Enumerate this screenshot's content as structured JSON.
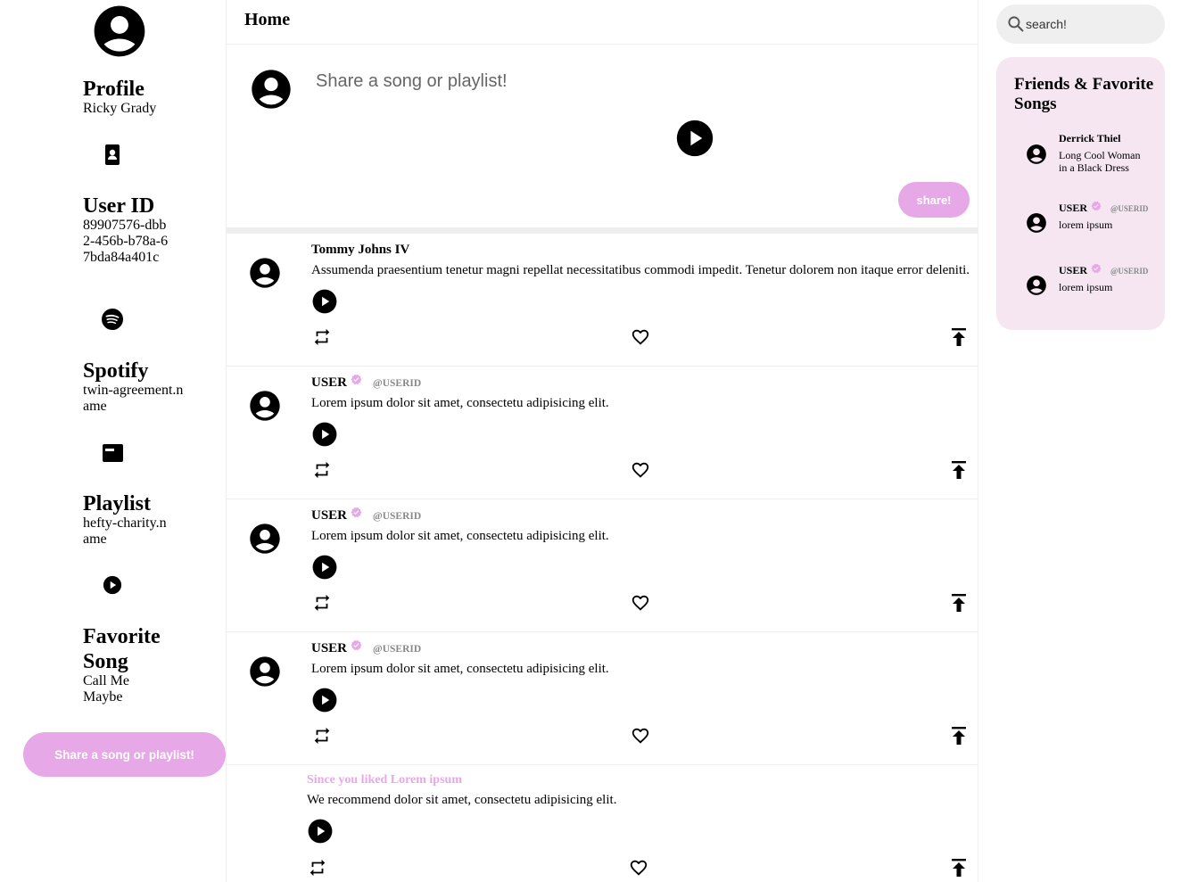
{
  "sidebar": {
    "profile_heading": "Profile",
    "profile_value": "Ricky Grady",
    "userid_heading": "User ID",
    "userid_value": "89907576-dbb2-456b-b78a-67bda84a401c",
    "spotify_heading": "Spotify",
    "spotify_value": "twin-agreement.name",
    "playlist_heading": "Playlist",
    "playlist_value": "hefty-charity.name",
    "favorite_heading": "Favorite Song",
    "favorite_value": "Call Me Maybe",
    "share_button": "Share a song or playlist!"
  },
  "main": {
    "title": "Home",
    "composer_placeholder": "Share a song or playlist!",
    "share_button": "share!",
    "posts": [
      {
        "name": "Tommy Johns IV",
        "verified": false,
        "handle": "",
        "text": "Assumenda praesentium tenetur magni repellat necessitatibus commodi impedit. Tenetur dolorem non itaque error deleniti."
      },
      {
        "name": "USER",
        "verified": true,
        "handle": "@USERID",
        "text": "Lorem ipsum dolor sit amet, consectetu adipisicing elit."
      },
      {
        "name": "USER",
        "verified": true,
        "handle": "@USERID",
        "text": "Lorem ipsum dolor sit amet, consectetu adipisicing elit."
      },
      {
        "name": "USER",
        "verified": true,
        "handle": "@USERID",
        "text": "Lorem ipsum dolor sit amet, consectetu adipisicing elit."
      }
    ],
    "recommendation": {
      "title": "Since you liked Lorem ipsum",
      "text": "We recommend dolor sit amet, consectetu adipisicing elit."
    }
  },
  "right": {
    "search_placeholder": "search!",
    "friends_title": "Friends & Favorite Songs",
    "friends": [
      {
        "name": "Derrick Thiel",
        "handle": "",
        "song": "Long Cool Woman in a Black Dress"
      },
      {
        "name": "USER",
        "handle": "@USERID",
        "song": "lorem ipsum"
      },
      {
        "name": "USER",
        "handle": "@USERID",
        "song": "lorem ipsum"
      }
    ]
  },
  "colors": {
    "accent": "#e7a8e8",
    "panel": "#f5e6f2",
    "search_bg": "#efefef"
  },
  "icons": [
    "account-circle-icon",
    "contact-card-icon",
    "spotify-icon",
    "web-window-icon",
    "play-circle-icon",
    "retweet-icon",
    "heart-icon",
    "publish-icon",
    "verified-icon",
    "search-icon"
  ]
}
